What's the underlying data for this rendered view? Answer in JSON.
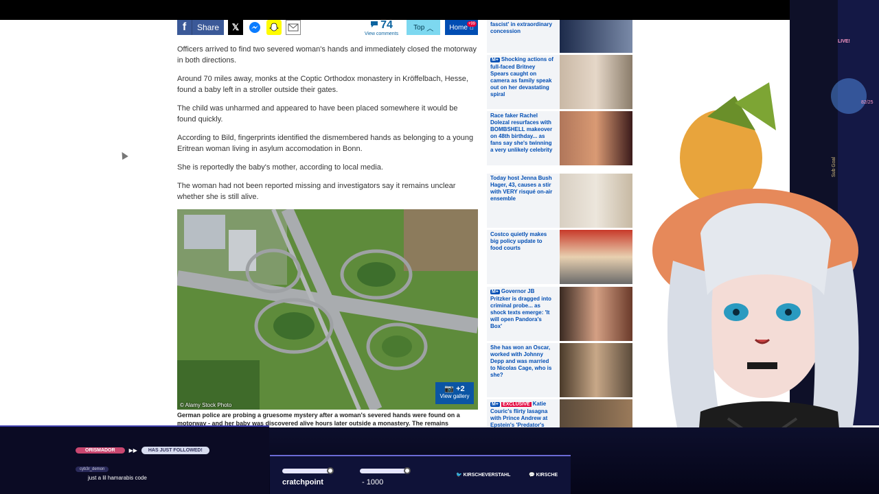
{
  "share_bar": {
    "facebook_label": "Share",
    "comment_count": "74",
    "comments_label": "View comments",
    "top_label": "Top",
    "home_label": "Home",
    "home_badge": "+99"
  },
  "article": {
    "paragraphs": [
      "Officers arrived to find two severed woman's hands and immediately closed the motorway in both directions.",
      "Around 70 miles away, monks at the Coptic Orthodox monastery in Kröffelbach, Hesse, found a baby left in a stroller outside their gates.",
      "The child was unharmed and appeared to have been placed somewhere it would be found quickly.",
      "According to Bild, fingerprints identified the dismembered hands as belonging to a young Eritrean woman living in asylum accomodation in Bonn.",
      "She is reportedly the baby's mother, according to local media.",
      "The woman had not been reported missing and investigators say it remains unclear whether she is still alive."
    ],
    "photo_credit": "© Alamy Stock Photo",
    "gallery_count": "+2",
    "gallery_label": "View gallery",
    "caption": "German police are probing a gruesome mystery after a woman's severed hands were found on a motorway - and her baby was discovered alive hours later outside a monastery. The remains"
  },
  "sidebar": {
    "items": [
      {
        "tag": "",
        "text": "fascist' in extraordinary concession"
      },
      {
        "tag": "M+",
        "text": "Shocking actions of full-faced Britney Spears caught on camera as family speak out on her devastating spiral"
      },
      {
        "tag": "",
        "text": "Race faker Rachel Dolezal resurfaces with BOMBSHELL makeover on 48th birthday... as fans say she's twinning a very unlikely celebrity"
      },
      {
        "tag": "",
        "text": "Today host Jenna Bush Hager, 43, causes a stir with VERY risqué on-air ensemble"
      },
      {
        "tag": "",
        "text": "Costco quietly makes big policy update to food courts"
      },
      {
        "tag": "M+",
        "text": "Governor JB Pritzker is dragged into criminal probe... as shock texts emerge: 'It will open Pandora's Box'"
      },
      {
        "tag": "",
        "text": "She has won an Oscar, worked with Johnny Depp and was married to Nicolas Cage, who is she?"
      },
      {
        "tag": "M+",
        "excl": "EXCLUSIVE",
        "text": "Katie Couric's flirty lasagna with Prince Andrew at Epstein's 'Predator's"
      }
    ]
  },
  "overlay": {
    "chat_name": "ORISMADOR",
    "chat_event": "HAS JUST FOLLOWED!",
    "chat_user": "cyb3r_demon",
    "chat_message": "just a lil hamarabis code",
    "hud_left_text": "cratchpoint",
    "hud_number": "1000",
    "social_1": "KIRSCHEVERSTAHL",
    "social_2": "KIRSCHE",
    "live_label": "LIVE!",
    "goal_count": "82/25",
    "goal_label": "Sub Goal"
  },
  "colors": {
    "link_blue": "#004db3",
    "brand_blue": "#004db3",
    "accent_red": "#e4003b"
  }
}
